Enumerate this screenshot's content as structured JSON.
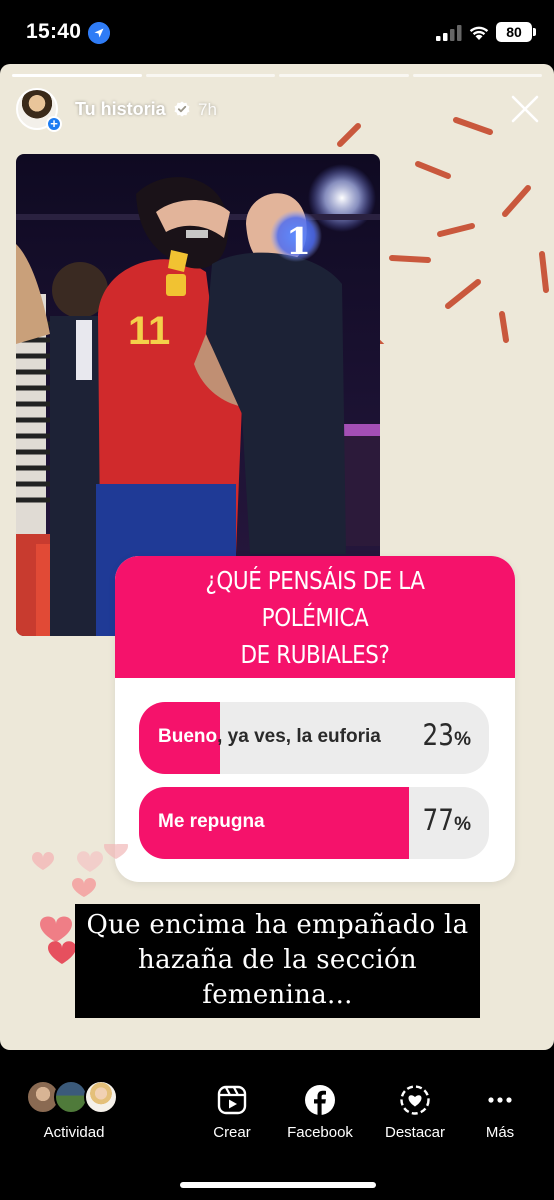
{
  "status_bar": {
    "time": "15:40",
    "battery": "80"
  },
  "story": {
    "user": "Tu historia",
    "time_ago": "7h",
    "progress_segments": 4,
    "active_segment": 0,
    "jersey_number": "11",
    "sticker_number": "1"
  },
  "poll": {
    "question_line1": "¿QUÉ PENSÁIS DE LA POLÉMICA",
    "question_line2": "DE RUBIALES?",
    "options": [
      {
        "label_highlight": "Bueno",
        "label_rest": ", ya ves, la euforia",
        "percent_value": "23",
        "percent_unit": "%",
        "fraction": 0.23
      },
      {
        "label_highlight": "Me repugna",
        "label_rest": "",
        "percent_value": "77",
        "percent_unit": "%",
        "fraction": 0.77
      }
    ],
    "accent_color": "#f5126b"
  },
  "caption": {
    "line1": "Que encima ha empañado la",
    "line2": "hazaña de la sección",
    "line3": "femenina..."
  },
  "bottom_bar": {
    "items": [
      {
        "label": "Actividad",
        "icon": "activity-avatars"
      },
      {
        "label": "Crear",
        "icon": "create-reel-icon"
      },
      {
        "label": "Facebook",
        "icon": "facebook-icon"
      },
      {
        "label": "Destacar",
        "icon": "highlight-icon"
      },
      {
        "label": "Más",
        "icon": "more-icon"
      }
    ]
  }
}
